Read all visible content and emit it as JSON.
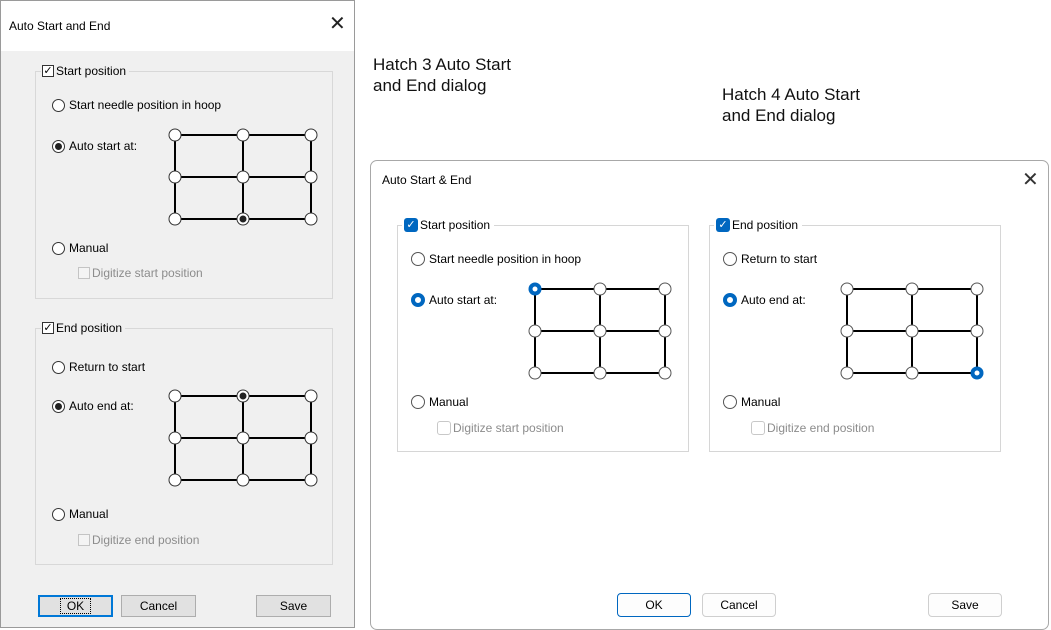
{
  "captions": {
    "hatch3": [
      "Hatch 3 Auto Start",
      "and End dialog"
    ],
    "hatch4": [
      "Hatch 4 Auto Start",
      "and End dialog"
    ]
  },
  "hatch3": {
    "title": "Auto Start and End",
    "start_group": {
      "label": "Start position",
      "checked": true,
      "opt_hoop": "Start needle position in hoop",
      "opt_auto": "Auto start at:",
      "opt_manual": "Manual",
      "digitize": "Digitize start position",
      "selected_point": 7
    },
    "end_group": {
      "label": "End position",
      "checked": true,
      "opt_return": "Return to start",
      "opt_auto": "Auto end at:",
      "opt_manual": "Manual",
      "digitize": "Digitize end position",
      "selected_point": 1
    },
    "buttons": {
      "ok": "OK",
      "cancel": "Cancel",
      "save": "Save"
    }
  },
  "hatch4": {
    "title": "Auto Start & End",
    "start_group": {
      "label": "Start position",
      "checked": true,
      "opt_hoop": "Start needle position in hoop",
      "opt_auto": "Auto start at:",
      "opt_manual": "Manual",
      "digitize": "Digitize start position",
      "selected_point": 0
    },
    "end_group": {
      "label": "End position",
      "checked": true,
      "opt_return": "Return to start",
      "opt_auto": "Auto end at:",
      "opt_manual": "Manual",
      "digitize": "Digitize end position",
      "selected_point": 8
    },
    "buttons": {
      "ok": "OK",
      "cancel": "Cancel",
      "save": "Save"
    }
  },
  "colors": {
    "accent": "#0067c0",
    "legacy_focus": "#0078d7",
    "dialog_bg_legacy": "#f0f0f0"
  }
}
